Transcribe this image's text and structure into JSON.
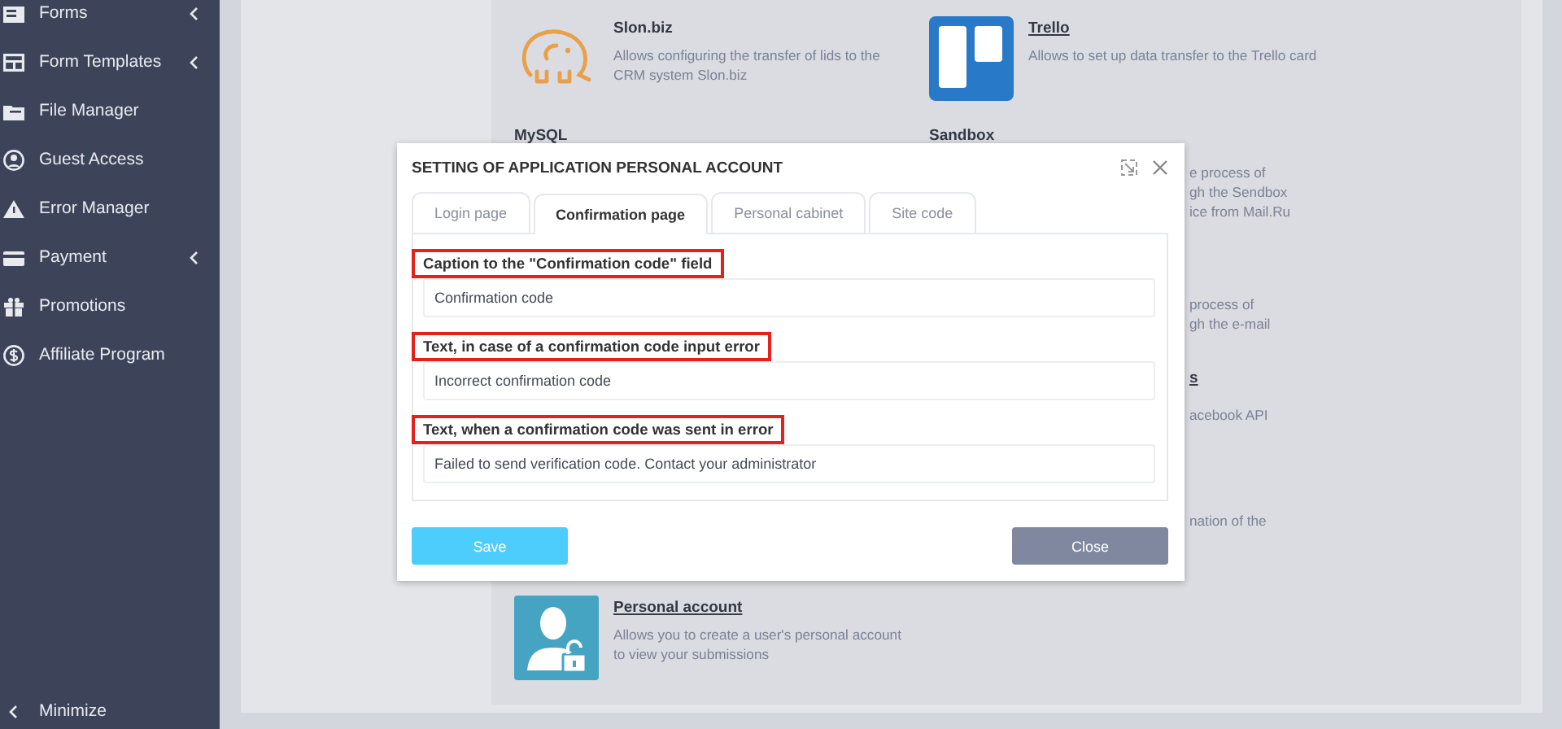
{
  "sidebar": {
    "items": [
      {
        "label": "Forms",
        "expandable": true
      },
      {
        "label": "Form Templates",
        "expandable": true
      },
      {
        "label": "File Manager",
        "expandable": false
      },
      {
        "label": "Guest Access",
        "expandable": false
      },
      {
        "label": "Error Manager",
        "expandable": false
      },
      {
        "label": "Payment",
        "expandable": true
      },
      {
        "label": "Promotions",
        "expandable": false
      },
      {
        "label": "Affiliate Program",
        "expandable": false
      }
    ],
    "minimize": {
      "label": "Minimize"
    }
  },
  "integrations": [
    {
      "left": {
        "title": "Slon.biz",
        "link": false,
        "description": [
          "Allows configuring the transfer of lids to the",
          "CRM system Slon.biz"
        ]
      },
      "right": {
        "title": "Trello",
        "link": true,
        "description": [
          "Allows to set up data transfer to the Trello card"
        ]
      }
    },
    {
      "left": {
        "title": "MySQL",
        "link": false
      },
      "right": {
        "title": "Sandbox",
        "link": false,
        "title_clipped": false,
        "clipped": true,
        "description": [
          "e process of",
          "gh the Sendbox",
          "ice from Mail.Ru"
        ]
      }
    },
    {
      "right": {
        "clipped": true,
        "description": [
          "process of",
          "gh the e-mail"
        ]
      }
    },
    {
      "right": {
        "title": "s",
        "link": true,
        "title_clipped": true,
        "clipped": true,
        "description": [
          "acebook API"
        ]
      }
    },
    {
      "right": {
        "clipped": true,
        "description": [
          "nation of the"
        ]
      }
    },
    {
      "left": {
        "title": "Personal account",
        "link": true,
        "description": [
          "Allows you to create a user's personal account",
          "to view your submissions"
        ]
      }
    }
  ],
  "dialog": {
    "title": "SETTING OF APPLICATION PERSONAL ACCOUNT",
    "tabs": [
      {
        "label": "Login page",
        "selected": false
      },
      {
        "label": "Confirmation page",
        "selected": true
      },
      {
        "label": "Personal cabinet",
        "selected": false
      },
      {
        "label": "Site code",
        "selected": false
      }
    ],
    "fields": [
      {
        "label": "Caption to the \"Confirmation code\" field",
        "highlighted": true,
        "value": "Confirmation code"
      },
      {
        "label": "Text, in case of a confirmation code input error",
        "highlighted": true,
        "value": "Incorrect confirmation code"
      },
      {
        "label": "Text, when a confirmation code was sent in error",
        "highlighted": true,
        "value": "Failed to send verification code. Contact your administrator"
      }
    ],
    "buttons": [
      {
        "label": "Save",
        "kind": "primary"
      },
      {
        "label": "Close",
        "kind": "secondary"
      }
    ]
  }
}
